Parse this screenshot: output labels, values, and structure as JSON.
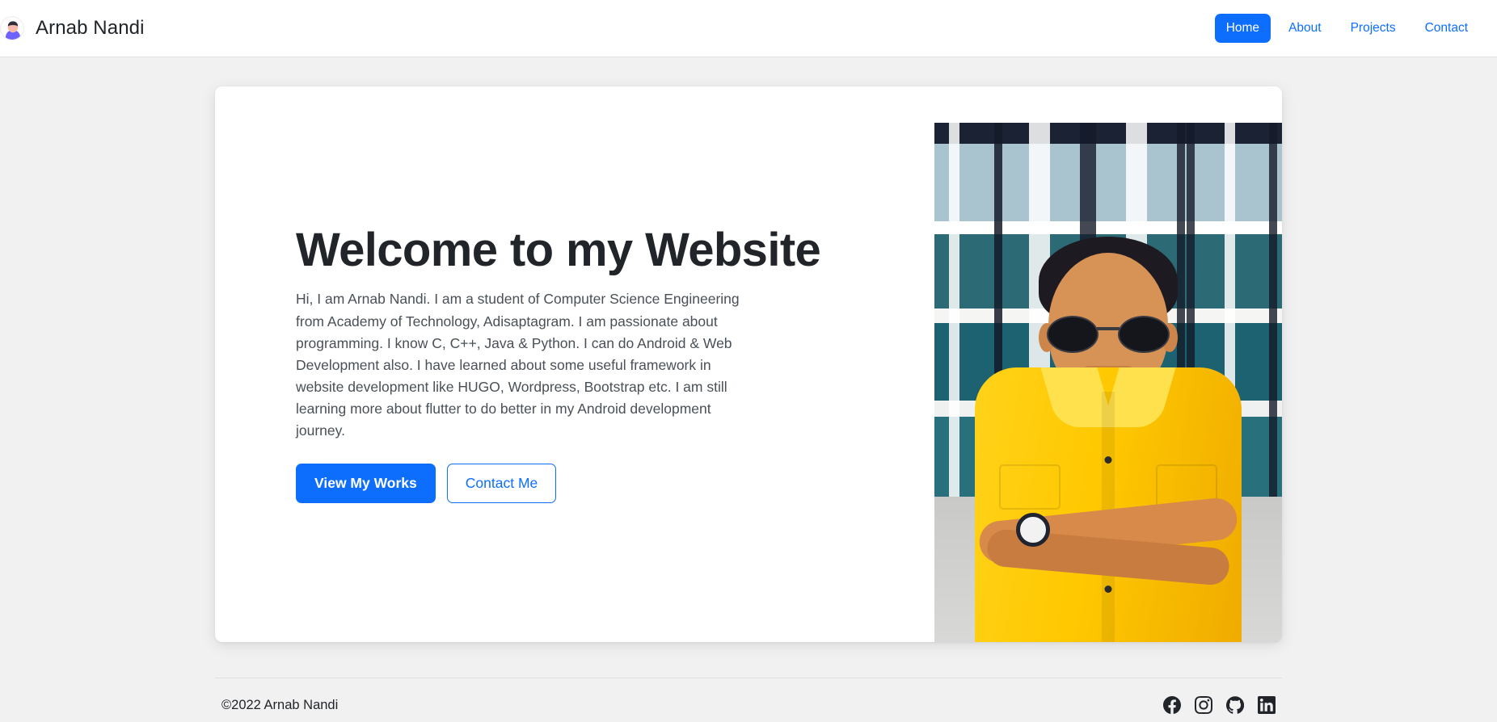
{
  "header": {
    "brand_name": "Arnab Nandi",
    "avatar_icon": "user-avatar-icon",
    "nav": [
      {
        "label": "Home",
        "active": true
      },
      {
        "label": "About",
        "active": false
      },
      {
        "label": "Projects",
        "active": false
      },
      {
        "label": "Contact",
        "active": false
      }
    ]
  },
  "hero": {
    "title": "Welcome to my Website",
    "body": "Hi, I am Arnab Nandi. I am a student of Computer Science Engineering from Academy of Technology, Adisaptagram. I am passionate about programming. I know C, C++, Java & Python. I can do Android & Web Development also. I have learned about some useful framework in website development like HUGO, Wordpress, Bootstrap etc. I am still learning more about flutter to do better in my Android development journey.",
    "primary_button": "View My Works",
    "secondary_button": "Contact Me",
    "photo_alt": "Portrait photo of Arnab Nandi wearing sunglasses and a yellow shirt in front of a glass office building"
  },
  "footer": {
    "copyright": "©2022 Arnab Nandi",
    "socials": [
      {
        "name": "facebook-icon"
      },
      {
        "name": "instagram-icon"
      },
      {
        "name": "github-icon"
      },
      {
        "name": "linkedin-icon"
      }
    ]
  },
  "colors": {
    "accent": "#0d6efd",
    "text_dark": "#212529",
    "text_muted": "#495057",
    "page_bg": "#f1f1f2",
    "card_bg": "#ffffff"
  }
}
